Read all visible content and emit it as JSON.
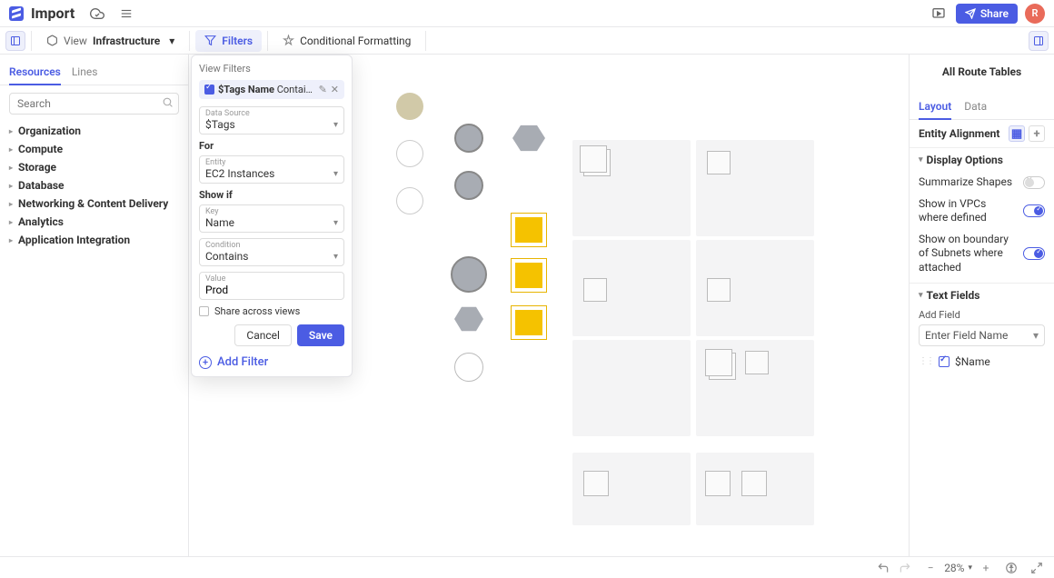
{
  "header": {
    "title": "Import",
    "share": "Share",
    "avatar": "R"
  },
  "toolbar": {
    "view_label": "View",
    "view_name": "Infrastructure",
    "filters": "Filters",
    "cond_fmt": "Conditional Formatting"
  },
  "sidebar": {
    "tabs": {
      "resources": "Resources",
      "lines": "Lines"
    },
    "search_placeholder": "Search",
    "tree": [
      "Organization",
      "Compute",
      "Storage",
      "Database",
      "Networking & Content Delivery",
      "Analytics",
      "Application Integration"
    ]
  },
  "popover": {
    "title": "View Filters",
    "chip": {
      "attr": "$Tags Name",
      "cond": "Contains",
      "val": "Prod"
    },
    "data_source": {
      "label": "Data Source",
      "value": "$Tags"
    },
    "for_label": "For",
    "entity": {
      "label": "Entity",
      "value": "EC2 Instances"
    },
    "show_if": "Show if",
    "key": {
      "label": "Key",
      "value": "Name"
    },
    "condition": {
      "label": "Condition",
      "value": "Contains"
    },
    "value": {
      "label": "Value",
      "value": "Prod"
    },
    "share": "Share across views",
    "cancel": "Cancel",
    "save": "Save",
    "add_filter": "Add Filter"
  },
  "right": {
    "title": "All Route Tables",
    "tabs": {
      "layout": "Layout",
      "data": "Data"
    },
    "entity_alignment": "Entity Alignment",
    "display_options": "Display Options",
    "summarize": "Summarize Shapes",
    "show_vpc": "Show in VPCs where defined",
    "show_subnet": "Show on boundary of Subnets where attached",
    "text_fields": "Text Fields",
    "add_field": "Add Field",
    "field_placeholder": "Enter Field Name",
    "name_field": "$Name"
  },
  "bottom": {
    "zoom": "28%"
  }
}
